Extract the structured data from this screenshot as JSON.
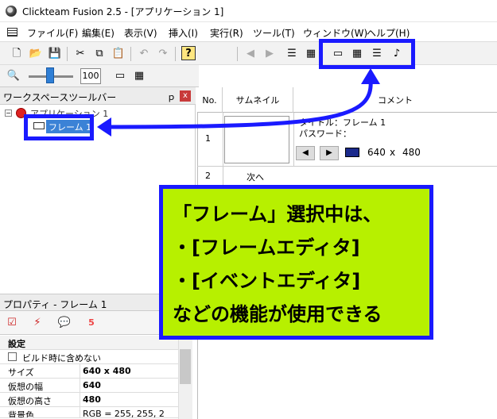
{
  "window": {
    "title": "Clickteam Fusion 2.5 - [アプリケーション 1]"
  },
  "menu": [
    "ファイル(F)",
    "編集(E)",
    "表示(V)",
    "挿入(I)",
    "実行(R)",
    "ツール(T)",
    "ウィンドウ(W)",
    "ヘルプ(H)"
  ],
  "toolbar2": {
    "zoom": "100"
  },
  "workspace": {
    "title": "ワークスペースツールバー",
    "pin": "ｐ",
    "close": "x",
    "app_node": "アプリケーション 1",
    "frame_node": "フレーム 1"
  },
  "properties": {
    "title": "プロパティ - フレーム 1",
    "section": "設定",
    "checkbox_label": "ビルド時に含めない",
    "rows": [
      {
        "key": "サイズ",
        "value": "640 x 480"
      },
      {
        "key": "仮想の幅",
        "value": "640"
      },
      {
        "key": "仮想の高さ",
        "value": "480"
      },
      {
        "key": "背景色",
        "value": "RGB = 255, 255, 2"
      }
    ]
  },
  "frame_list": {
    "headers": {
      "no": "No.",
      "thumbnail": "サムネイル",
      "comment": "コメント"
    },
    "row1": {
      "no": "1",
      "title_line": "タイトル：フレーム 1",
      "password_line": "パスワード：",
      "width": "640",
      "x": "x",
      "height": "480"
    },
    "row2": {
      "no": "2",
      "label": "次へ"
    }
  },
  "callout": {
    "line1": "「フレーム」選択中は、",
    "line2": "・[フレームエディタ]",
    "line3": "・[イベントエディタ]",
    "line4": "などの機能が使用できる"
  },
  "colors": {
    "highlight": "#1a1aff",
    "callout_bg": "#b7f000"
  }
}
